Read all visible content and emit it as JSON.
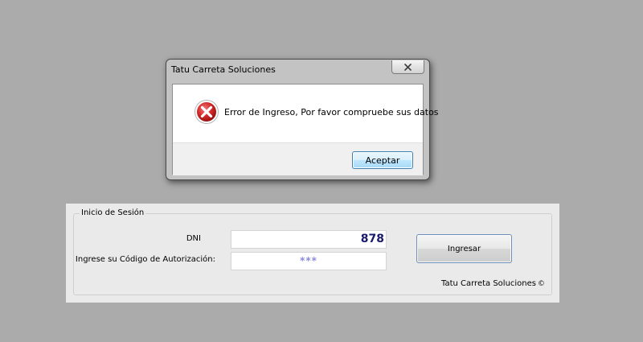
{
  "dialog": {
    "title": "Tatu Carreta Soluciones",
    "message": "Error de Ingreso, Por favor compruebe sus datos",
    "ok_label": "Aceptar",
    "icon": "error-icon",
    "close_icon": "close-icon"
  },
  "login": {
    "group_title": "Inicio de Sesión",
    "dni_label": "DNI",
    "dni_value": "878",
    "code_label": "Ingrese su Código de Autorización:",
    "code_value": "***",
    "submit_label": "Ingresar",
    "brand": "Tatu Carreta Soluciones",
    "brand_symbol": "©"
  },
  "colors": {
    "background": "#ababab",
    "panel": "#eaeaea",
    "error_red": "#d42c2c",
    "accent_blue": "#3c7fb1"
  }
}
